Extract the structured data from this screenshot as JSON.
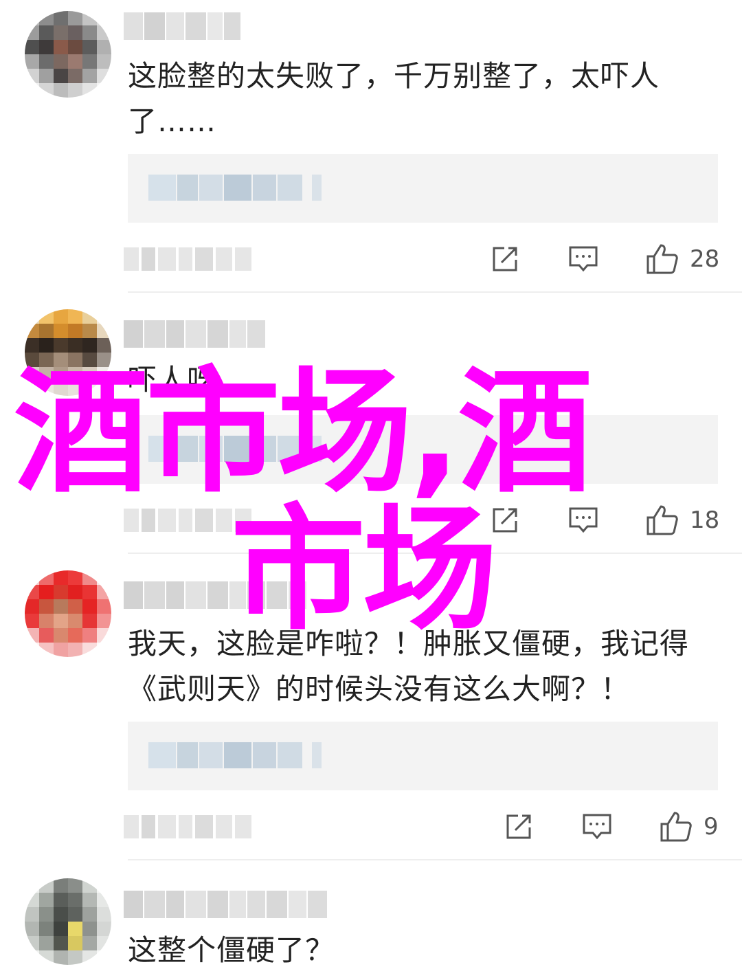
{
  "comments": [
    {
      "text": "这脸整的太失败了，千万别整了，太吓人了……",
      "likes": "28"
    },
    {
      "text": "吓人呀",
      "likes": "18"
    },
    {
      "text": "我天，这脸是咋啦？！肿胀又僵硬，我记得《武则天》的时候头没有这么大啊？！",
      "likes": "9"
    },
    {
      "text": "这整个僵硬了？"
    }
  ],
  "icons": {
    "share": "share-icon",
    "reply": "reply-icon",
    "like": "thumbs-up-icon"
  },
  "watermark": {
    "line1": "酒市场,酒",
    "line2": "市场",
    "color": "#ff00ff"
  }
}
